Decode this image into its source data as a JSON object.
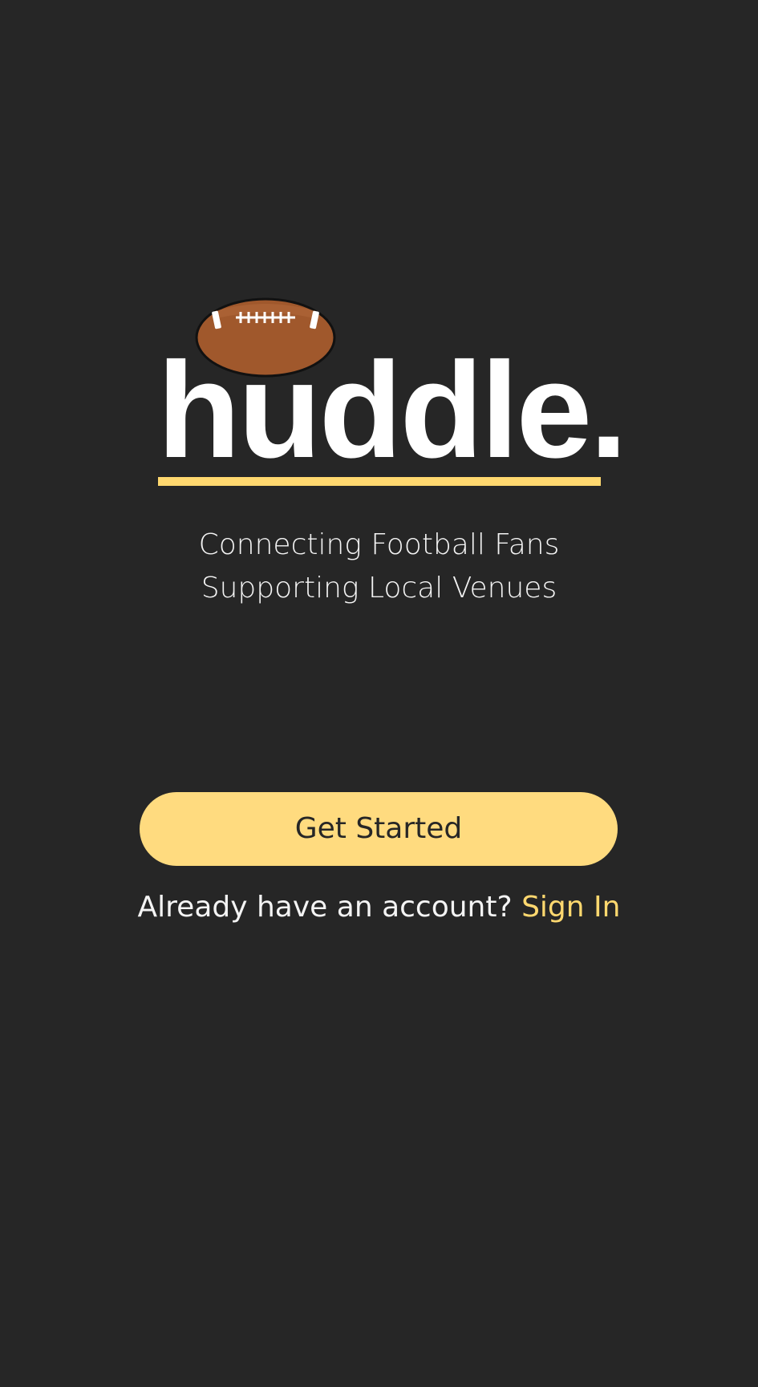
{
  "brand": {
    "name": "huddle.",
    "accent_color": "#ffd86f",
    "background_color": "#262626",
    "logo_icon": "football-icon"
  },
  "tagline": {
    "line1": "Connecting Football Fans",
    "line2": "Supporting Local Venues"
  },
  "actions": {
    "get_started_label": "Get Started",
    "already_have_account": "Already have an account?",
    "sign_in_label": "Sign In"
  }
}
